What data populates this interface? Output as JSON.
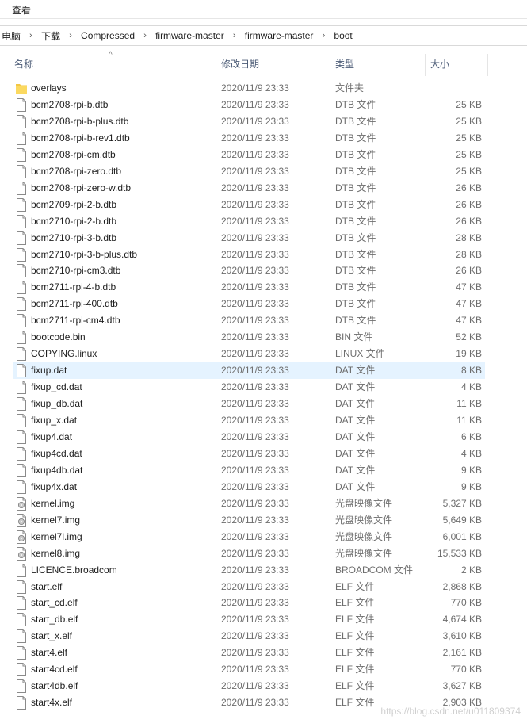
{
  "menubar": {
    "view_label": "查看"
  },
  "breadcrumb": [
    "电脑",
    "下载",
    "Compressed",
    "firmware-master",
    "firmware-master",
    "boot"
  ],
  "columns": {
    "name": "名称",
    "date": "修改日期",
    "type": "类型",
    "size": "大小"
  },
  "files": [
    {
      "name": "overlays",
      "date": "2020/11/9 23:33",
      "type": "文件夹",
      "size": "",
      "icon": "folder-icon"
    },
    {
      "name": "bcm2708-rpi-b.dtb",
      "date": "2020/11/9 23:33",
      "type": "DTB 文件",
      "size": "25 KB",
      "icon": "file-icon"
    },
    {
      "name": "bcm2708-rpi-b-plus.dtb",
      "date": "2020/11/9 23:33",
      "type": "DTB 文件",
      "size": "25 KB",
      "icon": "file-icon"
    },
    {
      "name": "bcm2708-rpi-b-rev1.dtb",
      "date": "2020/11/9 23:33",
      "type": "DTB 文件",
      "size": "25 KB",
      "icon": "file-icon"
    },
    {
      "name": "bcm2708-rpi-cm.dtb",
      "date": "2020/11/9 23:33",
      "type": "DTB 文件",
      "size": "25 KB",
      "icon": "file-icon"
    },
    {
      "name": "bcm2708-rpi-zero.dtb",
      "date": "2020/11/9 23:33",
      "type": "DTB 文件",
      "size": "25 KB",
      "icon": "file-icon"
    },
    {
      "name": "bcm2708-rpi-zero-w.dtb",
      "date": "2020/11/9 23:33",
      "type": "DTB 文件",
      "size": "26 KB",
      "icon": "file-icon"
    },
    {
      "name": "bcm2709-rpi-2-b.dtb",
      "date": "2020/11/9 23:33",
      "type": "DTB 文件",
      "size": "26 KB",
      "icon": "file-icon"
    },
    {
      "name": "bcm2710-rpi-2-b.dtb",
      "date": "2020/11/9 23:33",
      "type": "DTB 文件",
      "size": "26 KB",
      "icon": "file-icon"
    },
    {
      "name": "bcm2710-rpi-3-b.dtb",
      "date": "2020/11/9 23:33",
      "type": "DTB 文件",
      "size": "28 KB",
      "icon": "file-icon"
    },
    {
      "name": "bcm2710-rpi-3-b-plus.dtb",
      "date": "2020/11/9 23:33",
      "type": "DTB 文件",
      "size": "28 KB",
      "icon": "file-icon"
    },
    {
      "name": "bcm2710-rpi-cm3.dtb",
      "date": "2020/11/9 23:33",
      "type": "DTB 文件",
      "size": "26 KB",
      "icon": "file-icon"
    },
    {
      "name": "bcm2711-rpi-4-b.dtb",
      "date": "2020/11/9 23:33",
      "type": "DTB 文件",
      "size": "47 KB",
      "icon": "file-icon"
    },
    {
      "name": "bcm2711-rpi-400.dtb",
      "date": "2020/11/9 23:33",
      "type": "DTB 文件",
      "size": "47 KB",
      "icon": "file-icon"
    },
    {
      "name": "bcm2711-rpi-cm4.dtb",
      "date": "2020/11/9 23:33",
      "type": "DTB 文件",
      "size": "47 KB",
      "icon": "file-icon"
    },
    {
      "name": "bootcode.bin",
      "date": "2020/11/9 23:33",
      "type": "BIN 文件",
      "size": "52 KB",
      "icon": "file-icon"
    },
    {
      "name": "COPYING.linux",
      "date": "2020/11/9 23:33",
      "type": "LINUX 文件",
      "size": "19 KB",
      "icon": "file-icon"
    },
    {
      "name": "fixup.dat",
      "date": "2020/11/9 23:33",
      "type": "DAT 文件",
      "size": "8 KB",
      "icon": "file-icon",
      "selected": true
    },
    {
      "name": "fixup_cd.dat",
      "date": "2020/11/9 23:33",
      "type": "DAT 文件",
      "size": "4 KB",
      "icon": "file-icon"
    },
    {
      "name": "fixup_db.dat",
      "date": "2020/11/9 23:33",
      "type": "DAT 文件",
      "size": "11 KB",
      "icon": "file-icon"
    },
    {
      "name": "fixup_x.dat",
      "date": "2020/11/9 23:33",
      "type": "DAT 文件",
      "size": "11 KB",
      "icon": "file-icon"
    },
    {
      "name": "fixup4.dat",
      "date": "2020/11/9 23:33",
      "type": "DAT 文件",
      "size": "6 KB",
      "icon": "file-icon"
    },
    {
      "name": "fixup4cd.dat",
      "date": "2020/11/9 23:33",
      "type": "DAT 文件",
      "size": "4 KB",
      "icon": "file-icon"
    },
    {
      "name": "fixup4db.dat",
      "date": "2020/11/9 23:33",
      "type": "DAT 文件",
      "size": "9 KB",
      "icon": "file-icon"
    },
    {
      "name": "fixup4x.dat",
      "date": "2020/11/9 23:33",
      "type": "DAT 文件",
      "size": "9 KB",
      "icon": "file-icon"
    },
    {
      "name": "kernel.img",
      "date": "2020/11/9 23:33",
      "type": "光盘映像文件",
      "size": "5,327 KB",
      "icon": "disc-image-icon"
    },
    {
      "name": "kernel7.img",
      "date": "2020/11/9 23:33",
      "type": "光盘映像文件",
      "size": "5,649 KB",
      "icon": "disc-image-icon"
    },
    {
      "name": "kernel7l.img",
      "date": "2020/11/9 23:33",
      "type": "光盘映像文件",
      "size": "6,001 KB",
      "icon": "disc-image-icon"
    },
    {
      "name": "kernel8.img",
      "date": "2020/11/9 23:33",
      "type": "光盘映像文件",
      "size": "15,533 KB",
      "icon": "disc-image-icon"
    },
    {
      "name": "LICENCE.broadcom",
      "date": "2020/11/9 23:33",
      "type": "BROADCOM 文件",
      "size": "2 KB",
      "icon": "file-icon"
    },
    {
      "name": "start.elf",
      "date": "2020/11/9 23:33",
      "type": "ELF 文件",
      "size": "2,868 KB",
      "icon": "file-icon"
    },
    {
      "name": "start_cd.elf",
      "date": "2020/11/9 23:33",
      "type": "ELF 文件",
      "size": "770 KB",
      "icon": "file-icon"
    },
    {
      "name": "start_db.elf",
      "date": "2020/11/9 23:33",
      "type": "ELF 文件",
      "size": "4,674 KB",
      "icon": "file-icon"
    },
    {
      "name": "start_x.elf",
      "date": "2020/11/9 23:33",
      "type": "ELF 文件",
      "size": "3,610 KB",
      "icon": "file-icon"
    },
    {
      "name": "start4.elf",
      "date": "2020/11/9 23:33",
      "type": "ELF 文件",
      "size": "2,161 KB",
      "icon": "file-icon"
    },
    {
      "name": "start4cd.elf",
      "date": "2020/11/9 23:33",
      "type": "ELF 文件",
      "size": "770 KB",
      "icon": "file-icon"
    },
    {
      "name": "start4db.elf",
      "date": "2020/11/9 23:33",
      "type": "ELF 文件",
      "size": "3,627 KB",
      "icon": "file-icon"
    },
    {
      "name": "start4x.elf",
      "date": "2020/11/9 23:33",
      "type": "ELF 文件",
      "size": "2,903 KB",
      "icon": "file-icon"
    }
  ],
  "watermark": "https://blog.csdn.net/u011809374",
  "colors": {
    "selected_row": "#e5f3ff",
    "folder": "#f3c744",
    "header_text": "#4a5a75"
  }
}
